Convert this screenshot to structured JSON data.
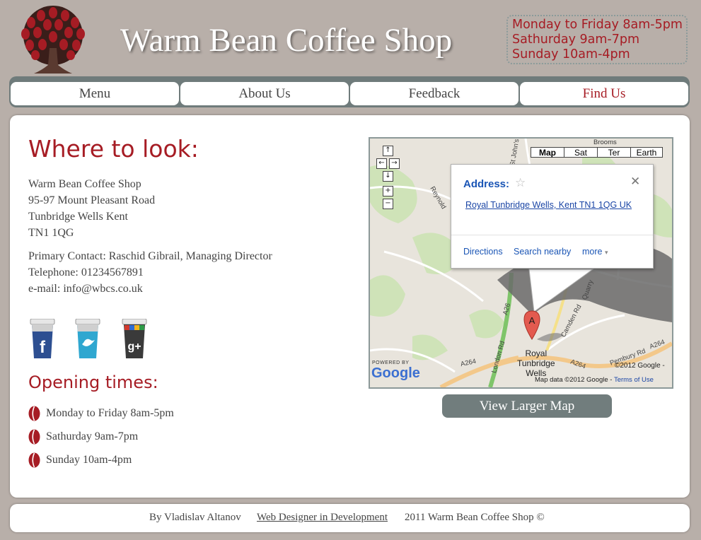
{
  "header": {
    "title": "Warm Bean Coffee Shop",
    "hours": [
      "Monday to Friday 8am-5pm",
      "Sathurday 9am-7pm",
      "Sunday 10am-4pm"
    ]
  },
  "nav": {
    "items": [
      {
        "label": "Menu"
      },
      {
        "label": "About Us"
      },
      {
        "label": "Feedback"
      },
      {
        "label": "Find Us",
        "active": true
      }
    ]
  },
  "main": {
    "heading": "Where to look:",
    "address": [
      "Warm Bean Coffee Shop",
      "95-97 Mount Pleasant Road",
      "Tunbridge Wells Kent",
      "TN1 1QG"
    ],
    "contact": {
      "primary": "Primary Contact: Raschid Gibrail, Managing Director",
      "telephone": "Telephone: 01234567891",
      "email": "e-mail: info@wbcs.co.uk"
    },
    "social": [
      "facebook",
      "twitter",
      "google-plus"
    ],
    "opening_heading": "Opening times:",
    "opening_times": [
      "Monday to Friday 8am-5pm",
      "Sathurday 9am-7pm",
      "Sunday 10am-4pm"
    ]
  },
  "map": {
    "types": [
      "Map",
      "Sat",
      "Ter",
      "Earth"
    ],
    "selected_type": "Map",
    "infowindow": {
      "title": "Address:",
      "address": "Royal Tunbridge Wells, Kent TN1 1QG UK",
      "links": [
        "Directions",
        "Search nearby",
        "more"
      ]
    },
    "marker_label": "A",
    "place_label": [
      "Royal",
      "Tunbridge",
      "Wells"
    ],
    "roads": [
      "A26",
      "London Rd",
      "A264",
      "Camden Rd",
      "Pembury Rd",
      "Quarry",
      "St John's",
      "Reynold"
    ],
    "place_top": "Brooms",
    "copyright": "©2012 Google -",
    "map_data": "Map data ©2012 Google -",
    "terms": "Terms of Use",
    "powered_by": "POWERED BY",
    "google": "Google",
    "larger_map": "View Larger Map"
  },
  "footer": {
    "author": "By Vladislav Altanov",
    "link": "Web Designer in Development",
    "copyright": "2011 Warm Bean Coffee Shop ©"
  },
  "colors": {
    "background": "#b8afa9",
    "accent_red": "#a61c24",
    "nav_bar": "#6f7b7b",
    "text": "#444444"
  }
}
